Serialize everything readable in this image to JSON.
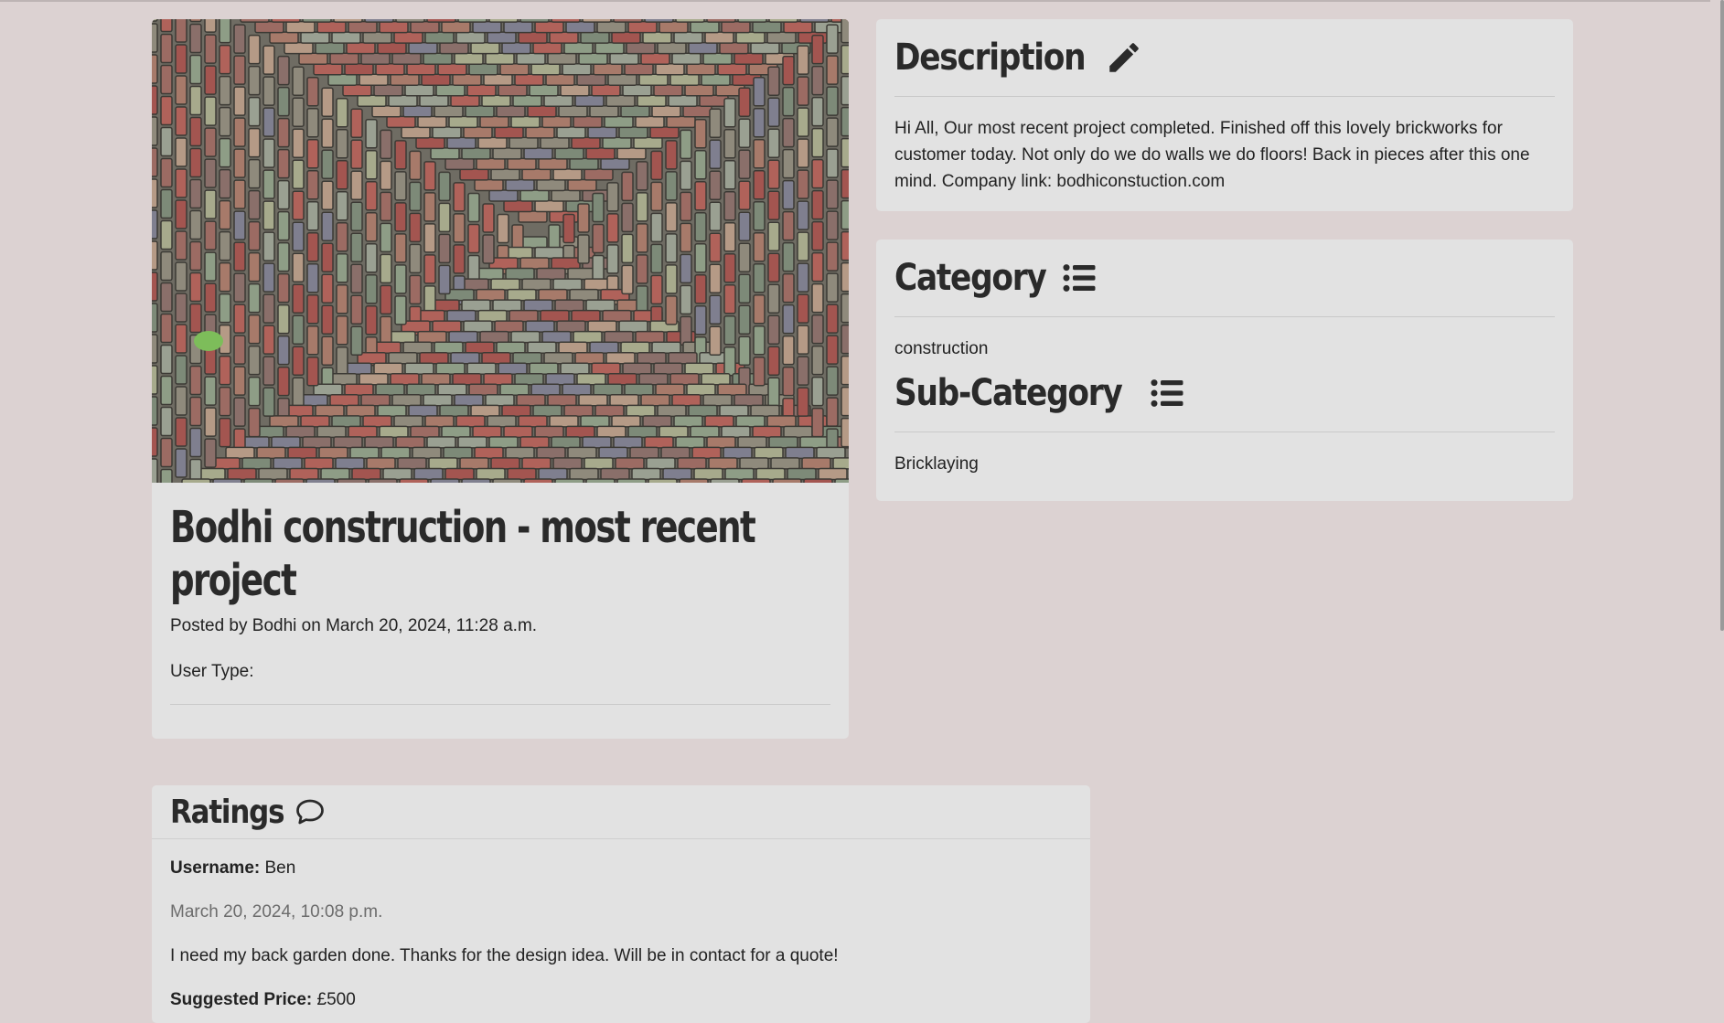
{
  "post": {
    "title": "Bodhi construction - most recent project",
    "posted_prefix": "Posted by",
    "author": "Bodhi",
    "posted_on_word": "on",
    "date": "March 20, 2024, 11:28 a.m.",
    "user_type_label": "User Type:",
    "image_name": "brick-paving-photo"
  },
  "description": {
    "heading": "Description",
    "icon": "pencil-icon",
    "text": "Hi All, Our most recent project completed. Finished off this lovely brickworks for customer today. Not only do we do walls we do floors! Back in pieces after this one mind. Company link: bodhiconstuction.com"
  },
  "category": {
    "heading": "Category",
    "icon": "list-icon",
    "value": "construction",
    "sub_heading": "Sub-Category",
    "sub_value": "Bricklaying"
  },
  "ratings": {
    "heading": "Ratings",
    "icon": "comment-icon",
    "items": [
      {
        "username_label": "Username:",
        "username": "Ben",
        "date": "March 20, 2024, 10:08 p.m.",
        "comment": "I need my back garden done. Thanks for the design idea. Will be in contact for a quote!",
        "price_label": "Suggested Price:",
        "price": "£500"
      }
    ]
  },
  "colors": {
    "page_bg": "#dcd2d2",
    "card_bg": "#e2e2e2",
    "text": "#222222"
  }
}
